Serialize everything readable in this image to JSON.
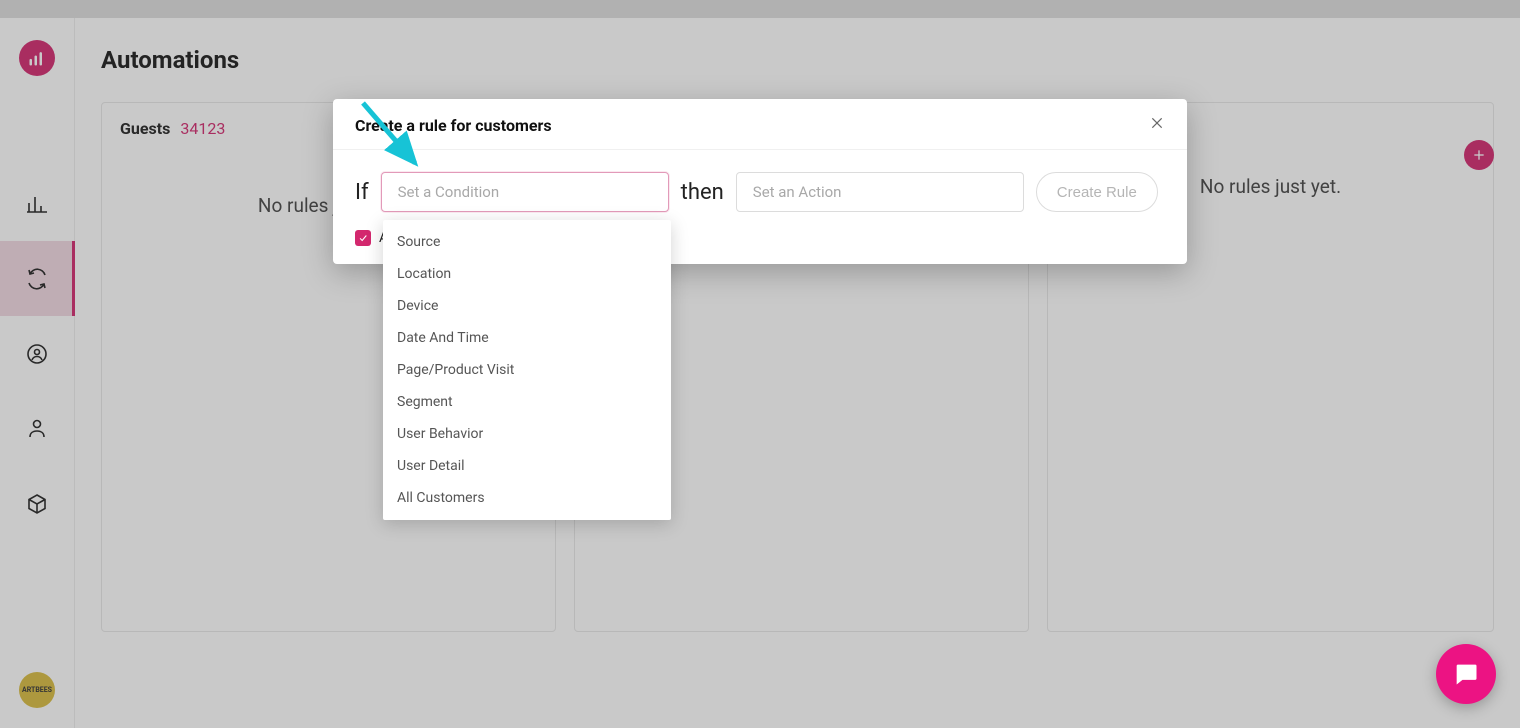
{
  "page": {
    "title": "Automations"
  },
  "guests": {
    "label": "Guests",
    "count": "34123"
  },
  "empty_state": {
    "left_text": "No rules just yet.",
    "right_text": "No rules just yet."
  },
  "modal": {
    "title": "Create a rule for customers",
    "if_label": "If",
    "then_label": "then",
    "condition_placeholder": "Set a Condition",
    "action_placeholder": "Set an Action",
    "create_rule_label": "Create Rule",
    "apply_checkbox_label": "Apply to all existing customers"
  },
  "condition_options": [
    "Source",
    "Location",
    "Device",
    "Date And Time",
    "Page/Product Visit",
    "Segment",
    "User Behavior",
    "User Detail",
    "All Customers"
  ],
  "sidebar": {
    "avatar_label": "ARTBEES"
  }
}
